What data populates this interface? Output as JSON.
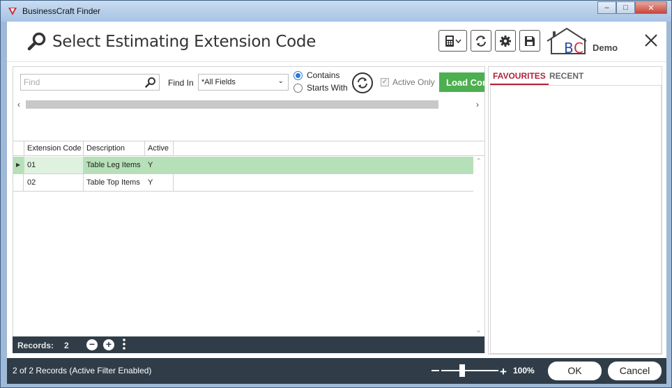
{
  "window": {
    "title": "BusinessCraft Finder",
    "minimize": "–",
    "maximize": "□",
    "close": "✕"
  },
  "header": {
    "page_title": "Select Estimating Extension Code",
    "tools": [
      "calculator-icon",
      "refresh-icon",
      "gear-icon",
      "save-icon"
    ],
    "logo_text": "BC",
    "demo_label": "Demo"
  },
  "search": {
    "placeholder": "Find",
    "find_in_label": "Find In",
    "find_in_value": "*All Fields",
    "radio_contains": "Contains",
    "radio_starts_with": "Starts With",
    "selected_mode": "Contains",
    "active_only_label": "Active Only",
    "active_only_checked": true,
    "load_button": "Load Cor"
  },
  "grid": {
    "columns": [
      "Extension Code",
      "Description",
      "Active"
    ],
    "rows": [
      {
        "code": "01",
        "description": "Table Leg Items",
        "active": "Y",
        "selected": true
      },
      {
        "code": "02",
        "description": "Table Top Items",
        "active": "Y",
        "selected": false
      }
    ]
  },
  "footer": {
    "records_label": "Records:",
    "records_count": "2"
  },
  "right_panel": {
    "tabs": [
      {
        "label": "FAVOURITES",
        "active": true
      },
      {
        "label": "RECENT",
        "active": false
      }
    ]
  },
  "statusbar": {
    "status_text": "2 of 2 Records (Active Filter Enabled)",
    "zoom_value": "100%",
    "zoom_level": 0.5,
    "ok_label": "OK",
    "cancel_label": "Cancel"
  },
  "colors": {
    "accent_green": "#4caf50",
    "selected_row": "#b6e0b8",
    "dark_bar": "#303d49",
    "tab_active": "#b0243a",
    "radio_blue": "#2a7ad4"
  }
}
